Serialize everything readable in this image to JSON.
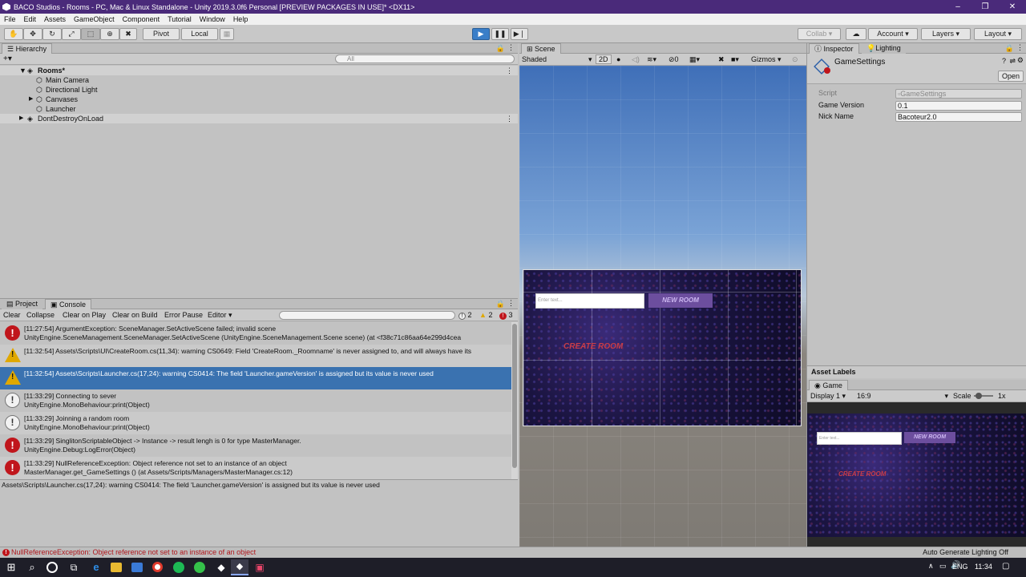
{
  "window": {
    "title": "BACO Studios - Rooms - PC, Mac & Linux Standalone - Unity 2019.3.0f6 Personal [PREVIEW PACKAGES IN USE]* <DX11>",
    "minimize": "–",
    "maximize": "❐",
    "close": "✕"
  },
  "menu": [
    "File",
    "Edit",
    "Assets",
    "GameObject",
    "Component",
    "Tutorial",
    "Window",
    "Help"
  ],
  "toolbar": {
    "pivot": "Pivot",
    "local": "Local",
    "collab": "Collab ▾",
    "account": "Account",
    "layers": "Layers",
    "layout": "Layout"
  },
  "hierarchy": {
    "tab": "Hierarchy",
    "add": "+▾",
    "search_placeholder": "All",
    "items": [
      {
        "label": "Rooms*",
        "bold": true
      },
      {
        "label": "Main Camera"
      },
      {
        "label": "Directional Light"
      },
      {
        "label": "Canvases"
      },
      {
        "label": "Launcher"
      },
      {
        "label": "DontDestroyOnLoad"
      }
    ]
  },
  "console": {
    "tabs": [
      "Project",
      "Console"
    ],
    "buttons": [
      "Clear",
      "Collapse",
      "Clear on Play",
      "Clear on Build",
      "Error Pause",
      "Editor ▾"
    ],
    "counts": {
      "info": "2",
      "warn": "2",
      "error": "3"
    },
    "rows": [
      {
        "type": "error",
        "line1": "[11:27:54] ArgumentException: SceneManager.SetActiveScene failed; invalid scene",
        "line2": "UnityEngine.SceneManagement.SceneManager.SetActiveScene (UnityEngine.SceneManagement.Scene scene) (at <f38c71c86aa64e299d4cea"
      },
      {
        "type": "warn",
        "line1": "[11:32:54] Assets\\Scripts\\UI\\CreateRoom.cs(11,34): warning CS0649: Field 'CreateRoom._Roomname' is never assigned to, and will always have its",
        "line2": ""
      },
      {
        "type": "warn",
        "line1": "[11:32:54] Assets\\Scripts\\Launcher.cs(17,24): warning CS0414: The field 'Launcher.gameVersion' is assigned but its value is never used",
        "line2": ""
      },
      {
        "type": "info",
        "line1": "[11:33:29] Connecting to sever",
        "line2": "UnityEngine.MonoBehaviour:print(Object)"
      },
      {
        "type": "info",
        "line1": "[11:33:29] Joinning a random room",
        "line2": "UnityEngine.MonoBehaviour:print(Object)"
      },
      {
        "type": "error",
        "line1": "[11:33:29] SinglitonScriptableObject -> Instance -> result lengh is 0 for type MasterManager.",
        "line2": "UnityEngine.Debug:LogError(Object)"
      },
      {
        "type": "error",
        "line1": "[11:33:29] NullReferenceException: Object reference not set to an instance of an object",
        "line2": "MasterManager.get_GameSettings () (at Assets/Scripts/Managers/MasterManager.cs:12)"
      }
    ],
    "detail": "Assets\\Scripts\\Launcher.cs(17,24): warning CS0414: The field 'Launcher.gameVersion' is assigned but its value is never used"
  },
  "scene": {
    "tab": "Scene",
    "shading": "Shaded",
    "mode2d": "2D",
    "gizmos": "Gizmos",
    "hidden_count": "0"
  },
  "game_ui": {
    "input_placeholder": "Enter text...",
    "new_room": "NEW ROOM",
    "create_room": "CREATE ROOM"
  },
  "inspector": {
    "tabs": [
      "Inspector",
      "Lighting"
    ],
    "object_name": "GameSettings",
    "open": "Open",
    "fields": [
      {
        "label": "Script",
        "value": "GameSettings",
        "disabled": true
      },
      {
        "label": "Game Version",
        "value": "0.1"
      },
      {
        "label": "Nick Name",
        "value": "Bacoteur2.0"
      }
    ],
    "asset_labels": "Asset Labels"
  },
  "game": {
    "tab": "Game",
    "display": "Display 1",
    "aspect": "16:9",
    "scale_label": "Scale",
    "scale_value": "1x"
  },
  "status": {
    "error": "NullReferenceException: Object reference not set to an instance of an object",
    "lighting": "Auto Generate Lighting Off"
  },
  "taskbar": {
    "lang": "ENG",
    "time": "11:34"
  },
  "colors": {
    "title_bg": "#4a2a7a",
    "selection": "#3a72b0",
    "error": "#c0161c",
    "warn": "#e0a800"
  }
}
